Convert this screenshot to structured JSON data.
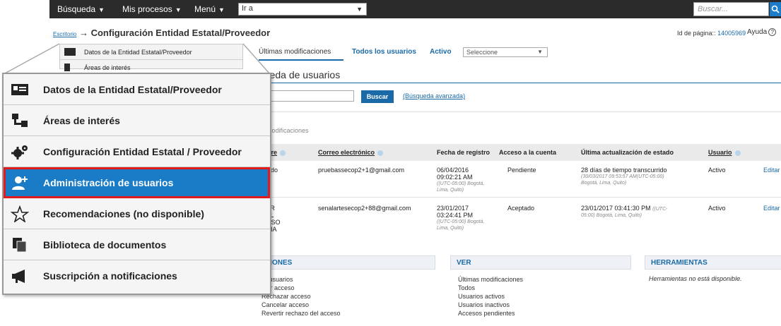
{
  "topbar": {
    "busqueda": "Búsqueda",
    "procesos": "Mis procesos",
    "menu": "Menú",
    "goto_value": "Ir a",
    "search_placeholder": "Buscar..."
  },
  "breadcrumb": {
    "link": "Escritorio",
    "arrow": "→",
    "title": "Configuración Entidad Estatal/Proveedor"
  },
  "page_id": {
    "label": "Id de página::",
    "value": "14005969"
  },
  "help_label": "Ayuda",
  "small_menu": [
    {
      "label": "Datos de la Entidad Estatal/Proveedor"
    },
    {
      "label": "Áreas de interés"
    }
  ],
  "tabs": {
    "ultimas": "Últimas modificaciones",
    "todos": "Todos los usuarios",
    "activo": "Activo",
    "select_value": "Seleccione"
  },
  "section_title": "Búsqueda de usuarios",
  "section_title_visible": "queda de usuarios",
  "search": {
    "button": "Buscar",
    "advanced": "(Búsqueda avanzada)"
  },
  "ultimas_label": "s modificaciones",
  "table": {
    "headers": {
      "nombre": "mbre",
      "correo": "Correo electrónico",
      "fecha": "Fecha de registro",
      "acceso": "Acceso a la cuenta",
      "ultima": "Última actualización de estado",
      "usuario": "Usuario"
    },
    "rows": [
      {
        "nombre_1": "nardo",
        "nombre_2": "a",
        "correo": "pruebassecop2+1@gmail.com",
        "fecha_1": "06/04/2016",
        "fecha_2": "09:02:21 AM",
        "fecha_sub_1": "((UTC-05:00) Bogotá,",
        "fecha_sub_2": "Lima, Quito)",
        "acceso": "Pendiente",
        "ultima_1": "28 días de tiempo transcurrido",
        "ultima_sub_1": "(30/03/2017 09:53:57 AM(UTC-05:00)",
        "ultima_sub_2": "Bogotá, Lima, Quito)",
        "usuario": "Activo",
        "accion": "Editar"
      },
      {
        "nombre_1": "TOR",
        "nombre_2": "UEL",
        "nombre_3": "ONSO",
        "nombre_4": "DINA",
        "correo": "senalartesecop2+88@gmail.com",
        "fecha_1": "23/01/2017",
        "fecha_2": "03:24:41 PM",
        "fecha_sub_1": "((UTC-05:00) Bogotá,",
        "fecha_sub_2": "Lima, Quito)",
        "acceso": "Aceptado",
        "ultima_1": "23/01/2017 03:41:30 PM",
        "ultima_1_sub": "((UTC-",
        "ultima_sub_2": "05:00) Bogotá, Lima, Quito)",
        "usuario": "Activo",
        "accion": "Editar"
      }
    ]
  },
  "panels": {
    "acciones": {
      "title": "CIONES",
      "items": [
        "ar usuarios",
        "ptar acceso",
        "Rechazar acceso",
        "Cancelar acceso",
        "Revertir rechazo del acceso"
      ]
    },
    "ver": {
      "title": "VER",
      "items": [
        "Últimas modificaciones",
        "Todos",
        "Usuarios activos",
        "Usuarios inactivos",
        "Accesos pendientes"
      ]
    },
    "herramientas": {
      "title": "HERRAMIENTAS",
      "message": "Herramientas no está disponible."
    }
  },
  "overlay_menu": [
    {
      "label": "Datos de la Entidad Estatal/Proveedor",
      "icon": "id-card-icon"
    },
    {
      "label": "Áreas de interés",
      "icon": "hierarchy-icon"
    },
    {
      "label": "Configuración Entidad Estatal / Proveedor",
      "icon": "gears-icon"
    },
    {
      "label": "Administración de usuarios",
      "icon": "add-user-icon",
      "active": true
    },
    {
      "label": "Recomendaciones (no disponible)",
      "icon": "star-icon"
    },
    {
      "label": "Biblioteca de documentos",
      "icon": "documents-icon"
    },
    {
      "label": "Suscripción a notificaciones",
      "icon": "megaphone-icon"
    }
  ],
  "colors": {
    "accent": "#1a7bc6",
    "highlight_border": "#e01b1b",
    "topbar": "#2b2b2b"
  }
}
